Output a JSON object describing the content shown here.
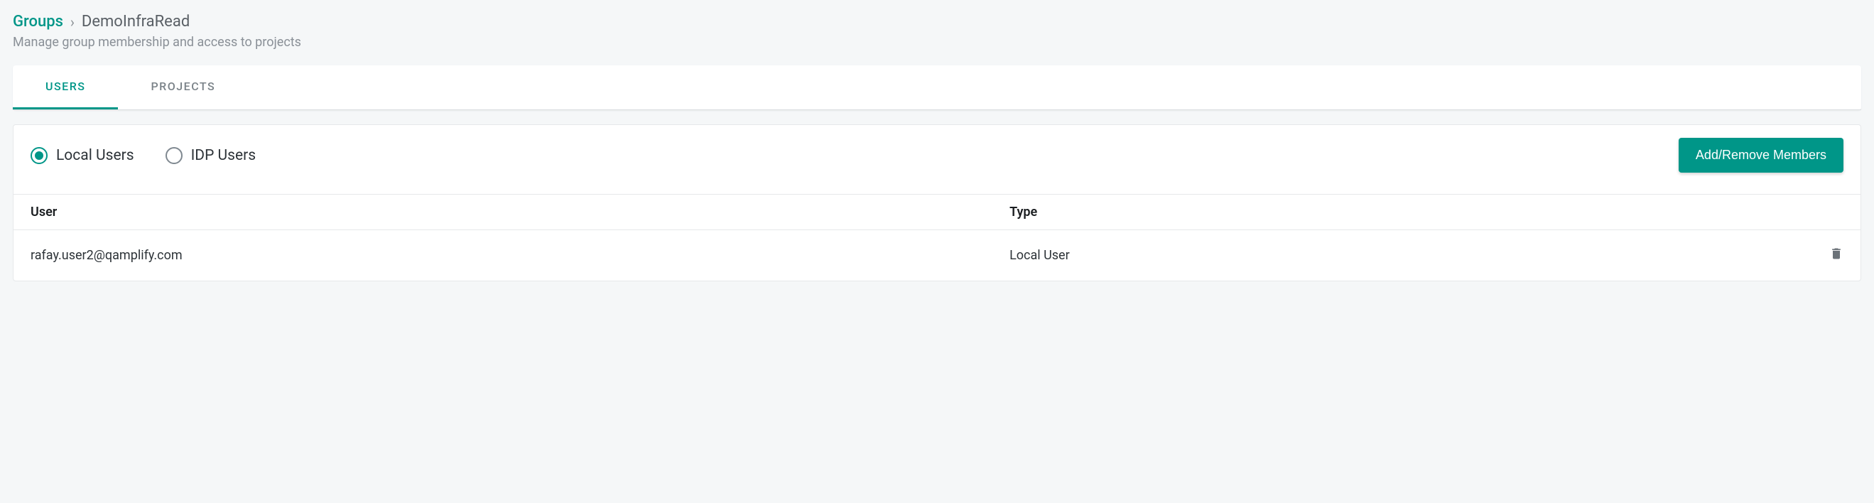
{
  "breadcrumb": {
    "root": "Groups",
    "separator": "›",
    "current": "DemoInfraRead"
  },
  "subtitle": "Manage group membership and access to projects",
  "tabs": {
    "users": "USERS",
    "projects": "PROJECTS",
    "active": "users"
  },
  "filter": {
    "local": "Local Users",
    "idp": "IDP Users"
  },
  "actions": {
    "add_remove": "Add/Remove Members"
  },
  "table": {
    "headers": {
      "user": "User",
      "type": "Type"
    },
    "rows": [
      {
        "user": "rafay.user2@qamplify.com",
        "type": "Local User"
      }
    ]
  }
}
